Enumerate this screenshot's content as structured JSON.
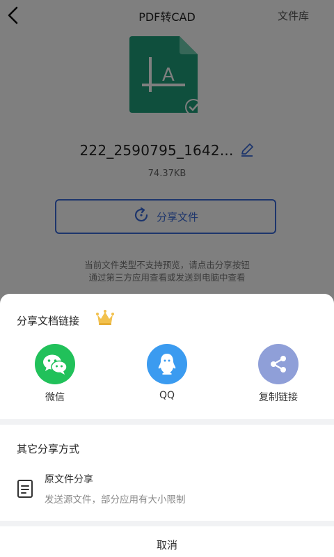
{
  "header": {
    "title": "PDF转CAD",
    "library_label": "文件库"
  },
  "file": {
    "name": "222_2590795_1642...",
    "size": "74.37KB"
  },
  "share_button_label": "分享文件",
  "hint_lines": [
    "当前文件类型不支持预览，请点击分享按钮",
    "通过第三方应用查看或发送到电脑中查看"
  ],
  "sheet": {
    "link_section_title": "分享文档链接",
    "options": [
      {
        "label": "微信",
        "icon": "wechat-icon",
        "color": "#21c15a"
      },
      {
        "label": "QQ",
        "icon": "qq-icon",
        "color": "#3b9bf0"
      },
      {
        "label": "复制链接",
        "icon": "share-link-icon",
        "color": "#8f9fd8"
      }
    ],
    "other_section_title": "其它分享方式",
    "original": {
      "title": "原文件分享",
      "desc": "发送源文件，部分应用有大小限制"
    },
    "cancel_label": "取消"
  },
  "colors": {
    "accent": "#3a6bd8",
    "file_icon": "#1f9e7b",
    "crown": "#f2c14e"
  }
}
